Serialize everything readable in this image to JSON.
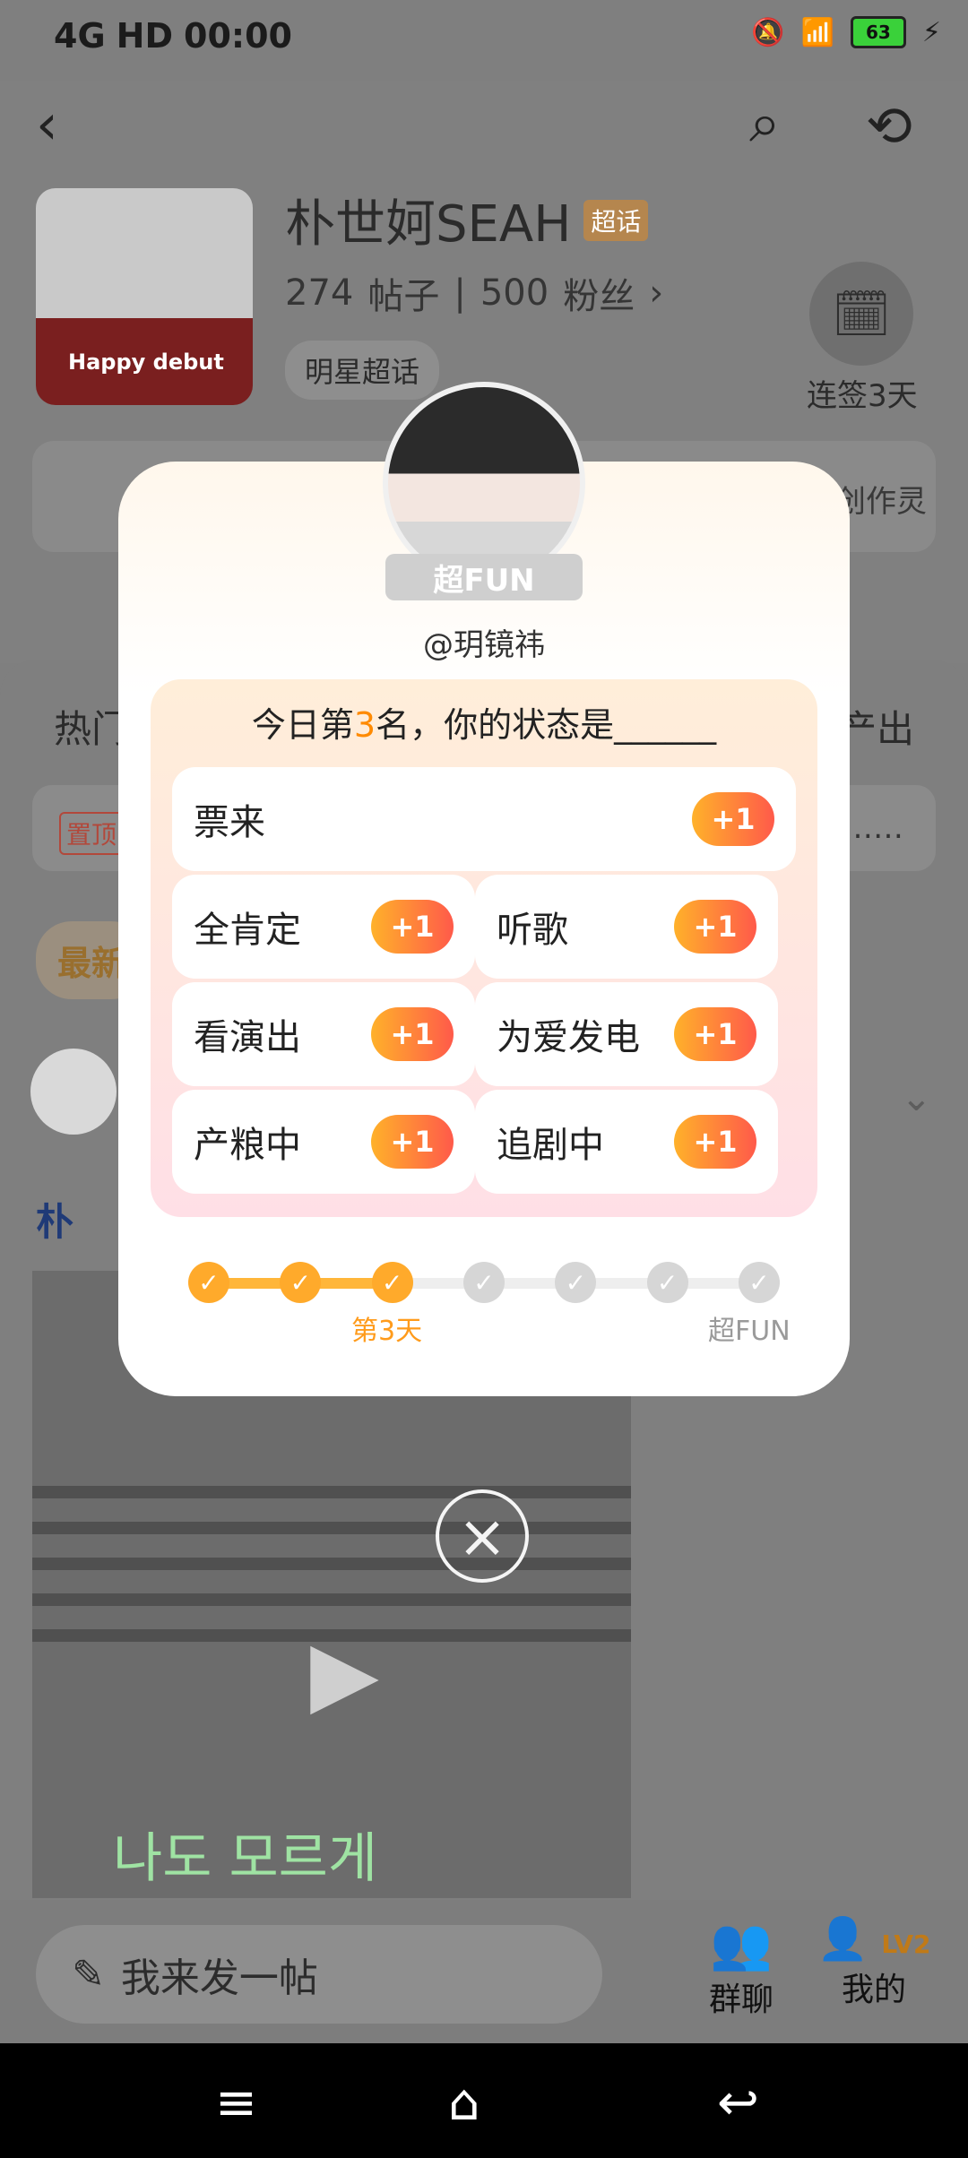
{
  "status_bar": {
    "network": "4G",
    "signal": "HD",
    "time": "00:00",
    "battery": "63"
  },
  "header": {
    "title": "朴世妸SEAH",
    "title_badge": "超话",
    "posts_count": "274",
    "posts_label": "帖子",
    "fans_count": "500",
    "fans_label": "粉丝",
    "tag": "明星超话",
    "checkin_label": "连签3天",
    "inspire_right": "创作灵"
  },
  "content": {
    "tab_left": "热门",
    "tab_right": "产出",
    "pinned_tag": "置顶",
    "pinned_more": "……",
    "latest_label": "最新",
    "poster_prefix": "朴",
    "video_text": "나도 모르게"
  },
  "bottom_bar": {
    "post_placeholder": "我来发一帖",
    "group_chat_label": "群聊",
    "me_label": "我的",
    "level_badge": "LV2"
  },
  "modal": {
    "ribbon": "超FUN",
    "username": "@玥镜祎",
    "prompt_prefix": "今日第",
    "rank": "3",
    "prompt_suffix": "名，你的状态是______",
    "options": [
      {
        "label": "票来",
        "action": "+1"
      },
      {
        "label": "全肯定",
        "action": "+1"
      },
      {
        "label": "听歌",
        "action": "+1"
      },
      {
        "label": "看演出",
        "action": "+1"
      },
      {
        "label": "为爱发电",
        "action": "+1"
      },
      {
        "label": "产粮中",
        "action": "+1"
      },
      {
        "label": "追剧中",
        "action": "+1"
      }
    ],
    "progress": {
      "total": 7,
      "completed": 3,
      "current_label": "第3天",
      "final_label": "超FUN"
    }
  },
  "icons": {
    "back": "chevron-left-icon",
    "search": "search-icon",
    "share": "share-icon",
    "checkin": "calendar-check-icon",
    "pen": "pen-icon",
    "close": "close-icon",
    "play": "play-icon"
  },
  "colors": {
    "accent_orange": "#ff8a00",
    "plus_gradient_start": "#ffb12a",
    "plus_gradient_end": "#ff5a4a",
    "overlay": "#7f7f7f"
  }
}
